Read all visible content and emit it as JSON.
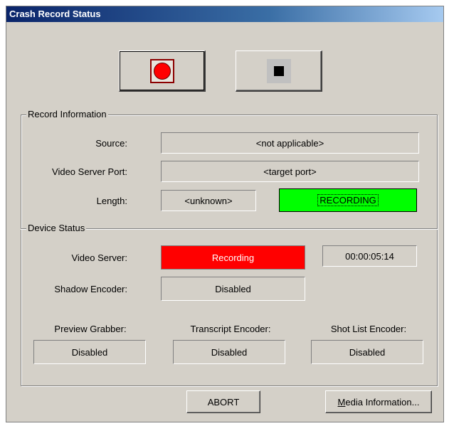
{
  "window": {
    "title": "Crash Record Status"
  },
  "controls": {
    "record_icon": "record-icon",
    "stop_icon": "stop-icon"
  },
  "record_info": {
    "group_title": "Record Information",
    "source_label": "Source:",
    "source_value": "<not applicable>",
    "port_label": "Video Server Port:",
    "port_value": "<target port>",
    "length_label": "Length:",
    "length_value": "<unknown>",
    "status_value": "RECORDING"
  },
  "device_status": {
    "group_title": "Device Status",
    "video_server_label": "Video Server:",
    "video_server_value": "Recording",
    "video_server_time": "00:00:05:14",
    "shadow_label": "Shadow Encoder:",
    "shadow_value": "Disabled",
    "preview_label": "Preview Grabber:",
    "preview_value": "Disabled",
    "transcript_label": "Transcript Encoder:",
    "transcript_value": "Disabled",
    "shotlist_label": "Shot List Encoder:",
    "shotlist_value": "Disabled"
  },
  "buttons": {
    "abort": "ABORT",
    "media_info_first": "M",
    "media_info_rest": "edia Information..."
  },
  "colors": {
    "recording_green": "#00ff00",
    "recording_red": "#ff0000",
    "dialog_bg": "#d4d0c8"
  }
}
